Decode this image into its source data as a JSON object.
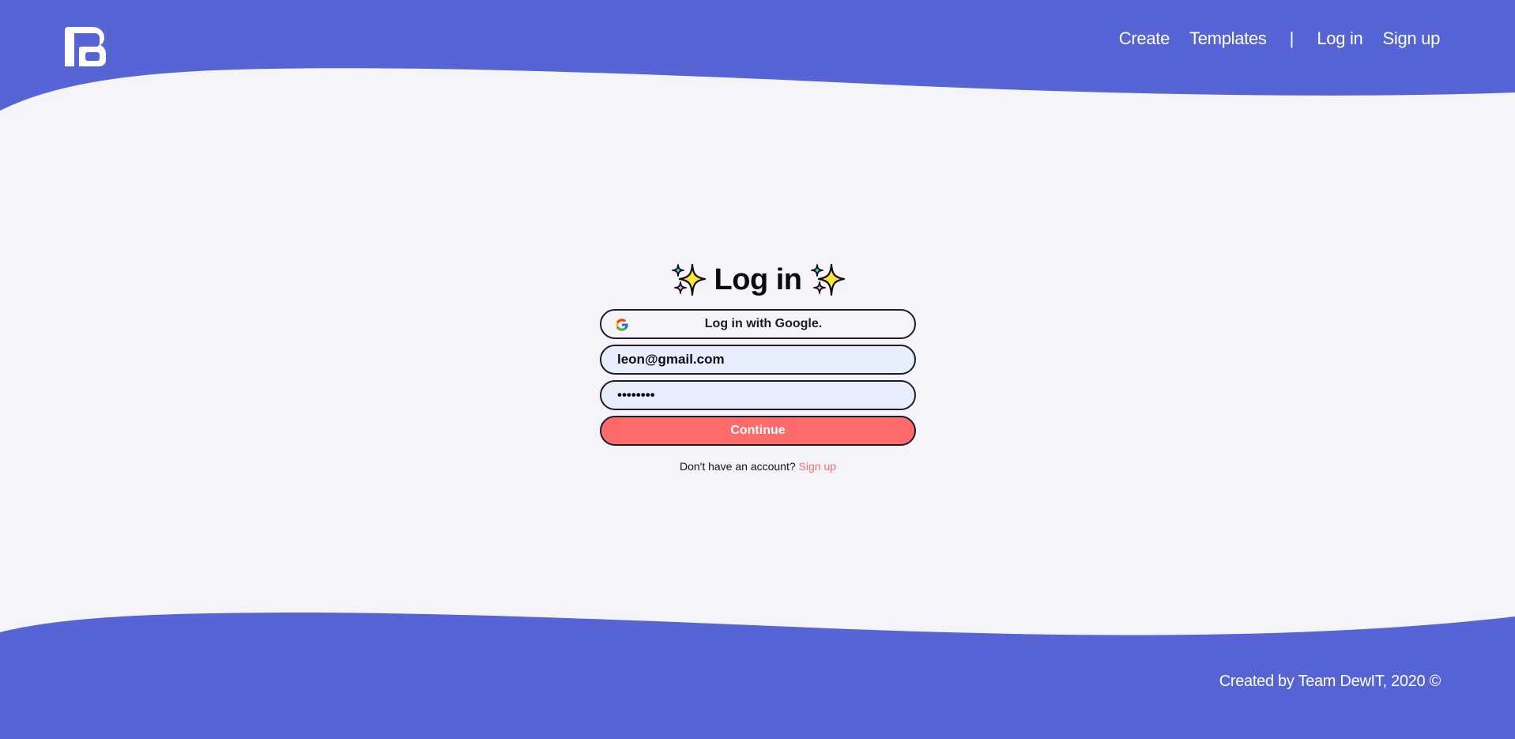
{
  "brand": {
    "logo_icon": "pb-logo-icon",
    "accent_color": "#5764d6",
    "background_color": "#f4f4f9"
  },
  "nav": {
    "create": "Create",
    "templates": "Templates",
    "divider": "|",
    "login": "Log in",
    "signup": "Sign up"
  },
  "login": {
    "title": "Log in",
    "title_icon": "sparkles-icon",
    "google_button": "Log in with Google.",
    "google_icon": "google-icon",
    "email_value": "leon@gmail.com",
    "password_value": "••••••••",
    "continue_button": "Continue",
    "continue_color": "#ff6b6b",
    "no_account_text": "Don't have an account?",
    "signup_link": "Sign up"
  },
  "footer": {
    "credit": "Created by Team DewIT, 2020 ©"
  }
}
